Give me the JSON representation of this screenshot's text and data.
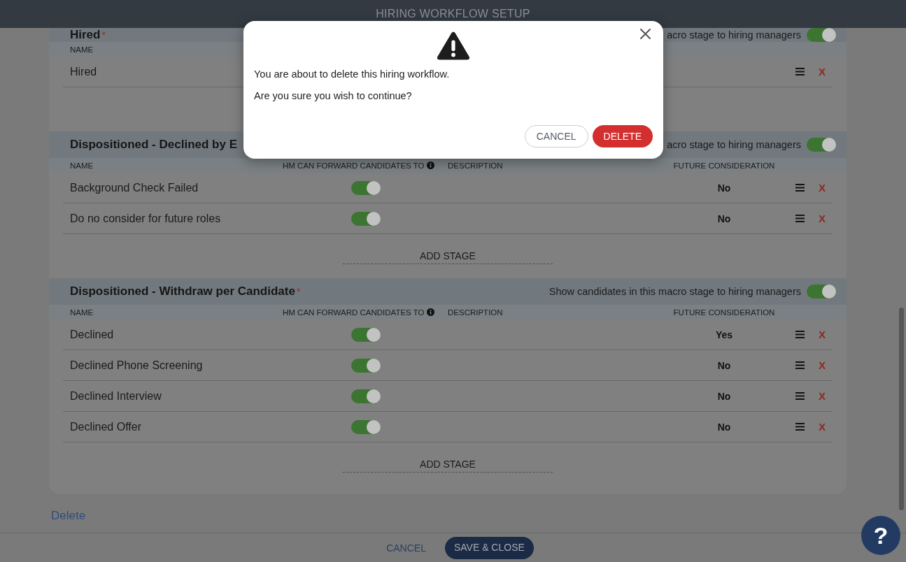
{
  "header": {
    "title": "HIRING WORKFLOW SETUP"
  },
  "sections": [
    {
      "title": "Hired",
      "required_mark": "*",
      "show_label": "acro stage to hiring managers",
      "show_on": true,
      "columns": [
        {
          "label": "NAME"
        }
      ],
      "rows": [
        {
          "name": "Hired",
          "remove": "X"
        }
      ]
    },
    {
      "title": "Dispositioned - Declined by E",
      "show_label": "acro stage to hiring managers",
      "show_on": true,
      "columns": [
        {
          "label": "NAME"
        },
        {
          "label": "HM CAN FORWARD CANDIDATES TO",
          "info": true
        },
        {
          "label": "DESCRIPTION"
        },
        {
          "label": "FUTURE CONSIDERATION"
        }
      ],
      "rows": [
        {
          "name": "Background Check Failed",
          "forward_on": true,
          "future": "No",
          "remove": "X"
        },
        {
          "name": "Do no consider for future roles",
          "forward_on": true,
          "future": "No",
          "remove": "X"
        }
      ],
      "add_stage": "ADD STAGE"
    },
    {
      "title": "Dispositioned - Withdraw per Candidate",
      "required_mark": "*",
      "show_label": "Show candidates in this macro stage to hiring managers",
      "show_on": true,
      "columns": [
        {
          "label": "NAME"
        },
        {
          "label": "HM CAN FORWARD CANDIDATES TO",
          "info": true
        },
        {
          "label": "DESCRIPTION"
        },
        {
          "label": "FUTURE CONSIDERATION"
        }
      ],
      "rows": [
        {
          "name": "Declined",
          "forward_on": true,
          "future": "Yes",
          "remove": "X"
        },
        {
          "name": "Declined Phone Screening",
          "forward_on": true,
          "future": "No",
          "remove": "X"
        },
        {
          "name": "Declined Interview",
          "forward_on": true,
          "future": "No",
          "remove": "X"
        },
        {
          "name": "Declined Offer",
          "forward_on": true,
          "future": "No",
          "remove": "X"
        }
      ],
      "add_stage": "ADD STAGE"
    }
  ],
  "delete_link": "Delete",
  "footer": {
    "buttons": [
      {
        "label": "CANCEL",
        "kind": "text"
      },
      {
        "label": "SAVE & CLOSE",
        "kind": "primary"
      }
    ]
  },
  "dialog": {
    "lines": [
      "You are about to delete this hiring workflow.",
      "Are you sure you wish to continue?"
    ],
    "buttons": [
      {
        "label": "CANCEL",
        "kind": "secondary"
      },
      {
        "label": "DELETE",
        "kind": "danger"
      }
    ]
  },
  "help": {
    "label": "?"
  }
}
